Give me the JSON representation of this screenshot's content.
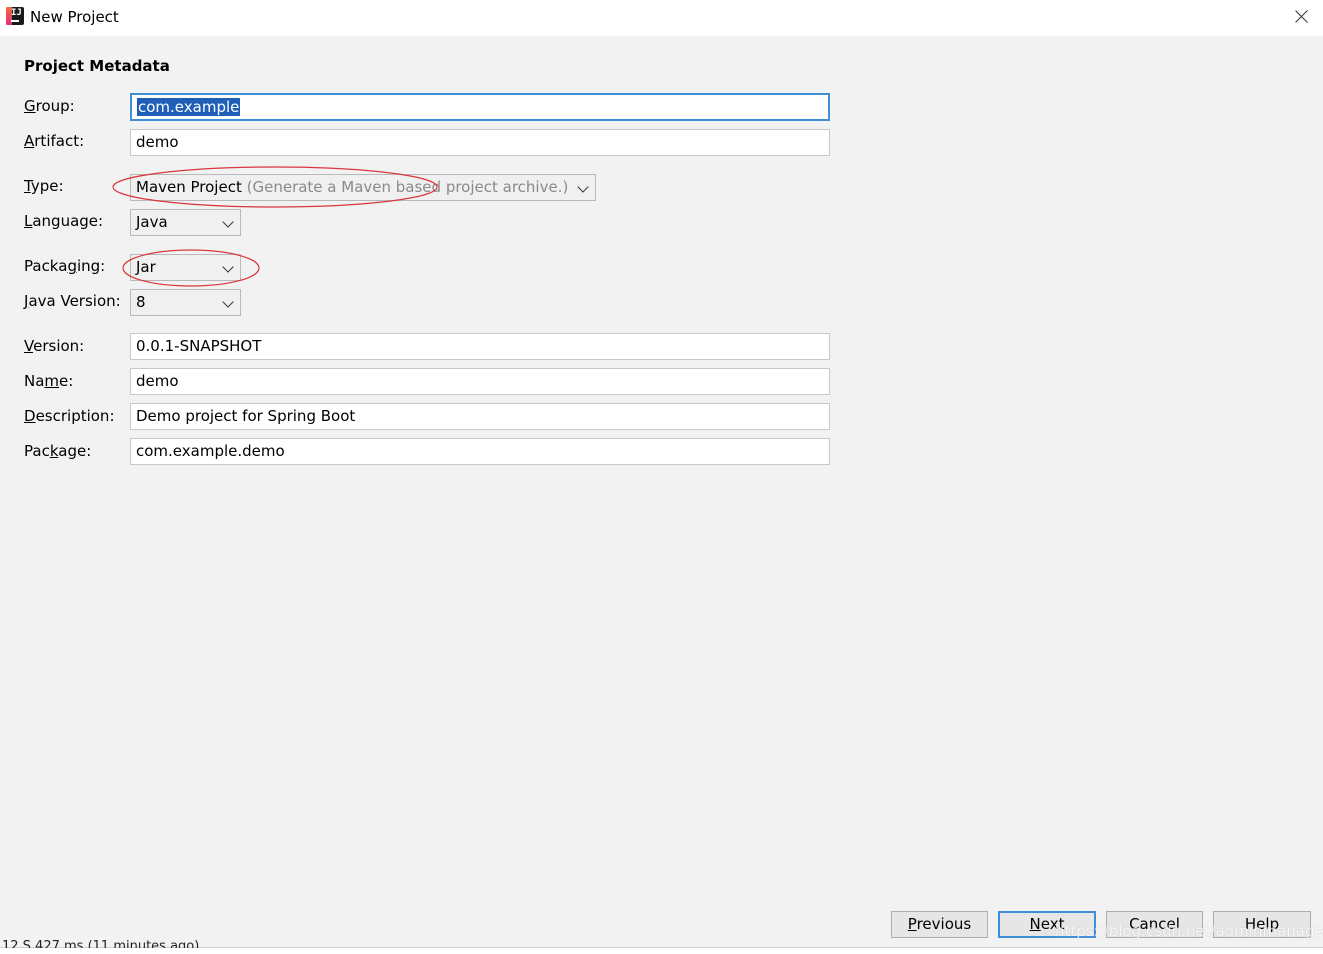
{
  "window": {
    "title": "New Project",
    "icon": "intellij-idea-icon"
  },
  "section_title": "Project Metadata",
  "fields": {
    "group": {
      "label_mn": "G",
      "label_rest": "roup:",
      "value": "com.example"
    },
    "artifact": {
      "label_mn": "A",
      "label_rest": "rtifact:",
      "value": "demo"
    },
    "type": {
      "label_mn": "T",
      "label_rest": "ype:",
      "value": "Maven Project",
      "description": "(Generate a Maven based project archive.)"
    },
    "language": {
      "label_mn": "L",
      "label_rest": "anguage:",
      "value": "Java"
    },
    "packaging": {
      "label_pre": "Packa",
      "label_mn": "g",
      "label_rest": "ing:",
      "value": "Jar"
    },
    "java_version": {
      "label_mn": "J",
      "label_rest": "ava Version:",
      "value": "8"
    },
    "version": {
      "label_mn": "V",
      "label_rest": "ersion:",
      "value": "0.0.1-SNAPSHOT"
    },
    "name": {
      "label_pre": "Na",
      "label_mn": "m",
      "label_rest": "e:",
      "value": "demo"
    },
    "description": {
      "label_mn": "D",
      "label_rest": "escription:",
      "value": "Demo project for Spring Boot"
    },
    "package": {
      "label_pre": "Pac",
      "label_mn": "k",
      "label_rest": "age:",
      "value": "com.example.demo"
    }
  },
  "buttons": {
    "previous": {
      "mn": "P",
      "rest": "revious"
    },
    "next": {
      "mn": "N",
      "rest": "ext"
    },
    "cancel": {
      "label": "Cancel"
    },
    "help": {
      "label": "Help"
    }
  },
  "watermark": "https://blog.csdn.net/adminmanaged",
  "background_text": "12 S 427 ms (11 minutes ago)",
  "colors": {
    "focus": "#3d8fd6",
    "selection": "#1f5fb8",
    "annotation": "#d9363e"
  }
}
